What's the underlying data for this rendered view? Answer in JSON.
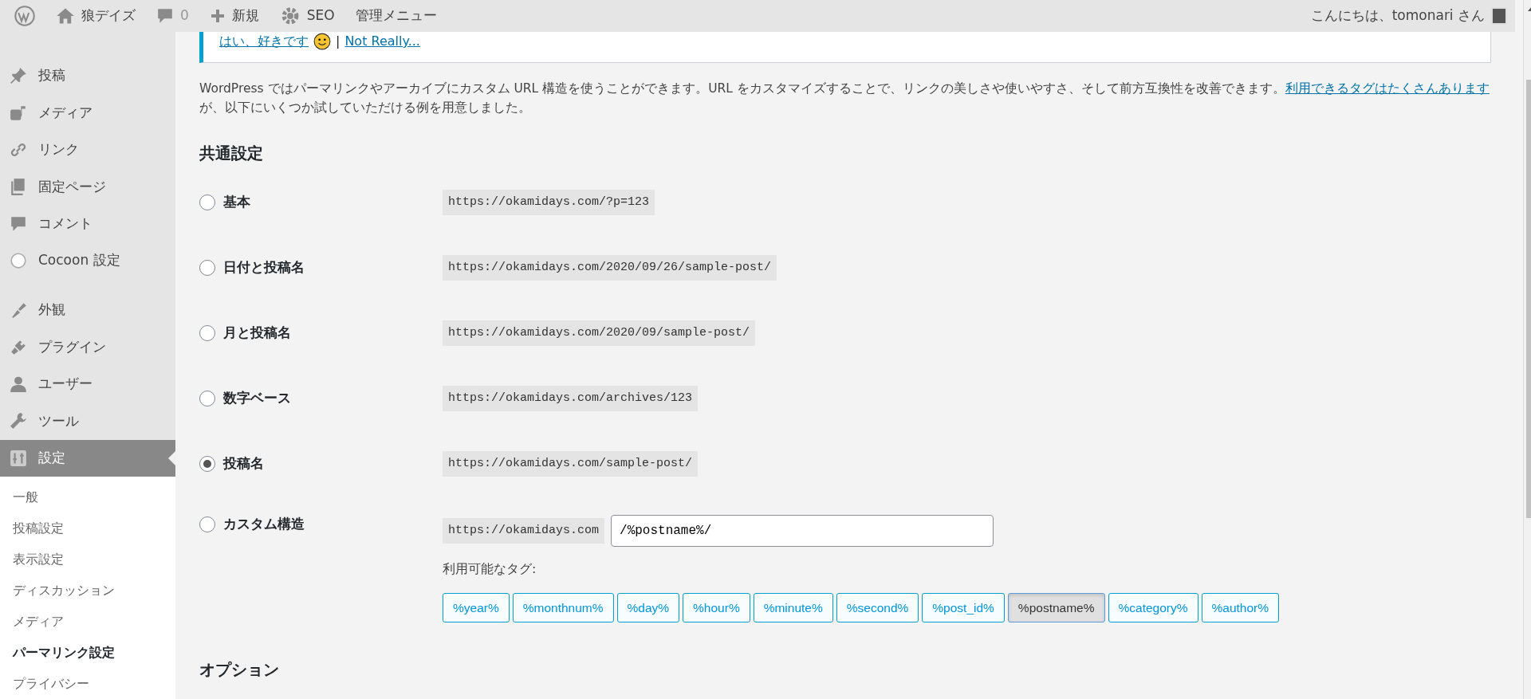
{
  "admin_bar": {
    "site": "狼デイズ",
    "comments": "0",
    "new": "新規",
    "seo": "SEO",
    "menu": "管理メニュー",
    "greeting": "こんにちは、tomonari さん"
  },
  "sidebar": {
    "items": [
      {
        "label": "投稿",
        "selected": false
      },
      {
        "label": "メディア",
        "selected": false
      },
      {
        "label": "リンク",
        "selected": false
      },
      {
        "label": "固定ページ",
        "selected": false
      },
      {
        "label": "コメント",
        "selected": false
      },
      {
        "label": "Cocoon 設定",
        "selected": false
      },
      {
        "label": "外観",
        "selected": false
      },
      {
        "label": "プラグイン",
        "selected": false
      },
      {
        "label": "ユーザー",
        "selected": false
      },
      {
        "label": "ツール",
        "selected": false
      },
      {
        "label": "設定",
        "selected": true
      }
    ],
    "submenu": [
      {
        "label": "一般",
        "selected": false
      },
      {
        "label": "投稿設定",
        "selected": false
      },
      {
        "label": "表示設定",
        "selected": false
      },
      {
        "label": "ディスカッション",
        "selected": false
      },
      {
        "label": "メディア",
        "selected": false
      },
      {
        "label": "パーマリンク設定",
        "selected": true
      },
      {
        "label": "プライバシー",
        "selected": false
      }
    ]
  },
  "notice": {
    "yes_link": "はい、好きです",
    "separator": "|",
    "no_link": "Not Really..."
  },
  "intro": {
    "text_before": "WordPress ではパーマリンクやアーカイブにカスタム URL 構造を使うことができます。URL をカスタマイズすることで、リンクの美しさや使いやすさ、そして前方互換性を改善できます。",
    "link": "利用できるタグはたくさんあります",
    "text_after": "が、以下にいくつか試していただける例を用意しました。"
  },
  "common_heading": "共通設定",
  "options": [
    {
      "kind": "preset",
      "label": "基本",
      "url": "https://okamidays.com/?p=123",
      "selected": false
    },
    {
      "kind": "preset",
      "label": "日付と投稿名",
      "url": "https://okamidays.com/2020/09/26/sample-post/",
      "selected": false
    },
    {
      "kind": "preset",
      "label": "月と投稿名",
      "url": "https://okamidays.com/2020/09/sample-post/",
      "selected": false
    },
    {
      "kind": "preset",
      "label": "数字ベース",
      "url": "https://okamidays.com/archives/123",
      "selected": false
    },
    {
      "kind": "preset",
      "label": "投稿名",
      "url": "https://okamidays.com/sample-post/",
      "selected": true
    },
    {
      "kind": "custom",
      "label": "カスタム構造",
      "url": "https://okamidays.com",
      "value": "/%postname%/",
      "selected": false
    }
  ],
  "tags_label": "利用可能なタグ:",
  "tags": [
    {
      "label": "%year%",
      "selected": false
    },
    {
      "label": "%monthnum%",
      "selected": false
    },
    {
      "label": "%day%",
      "selected": false
    },
    {
      "label": "%hour%",
      "selected": false
    },
    {
      "label": "%minute%",
      "selected": false
    },
    {
      "label": "%second%",
      "selected": false
    },
    {
      "label": "%post_id%",
      "selected": false
    },
    {
      "label": "%postname%",
      "selected": true
    },
    {
      "label": "%category%",
      "selected": false
    },
    {
      "label": "%author%",
      "selected": false
    }
  ],
  "options_heading": "オプション"
}
